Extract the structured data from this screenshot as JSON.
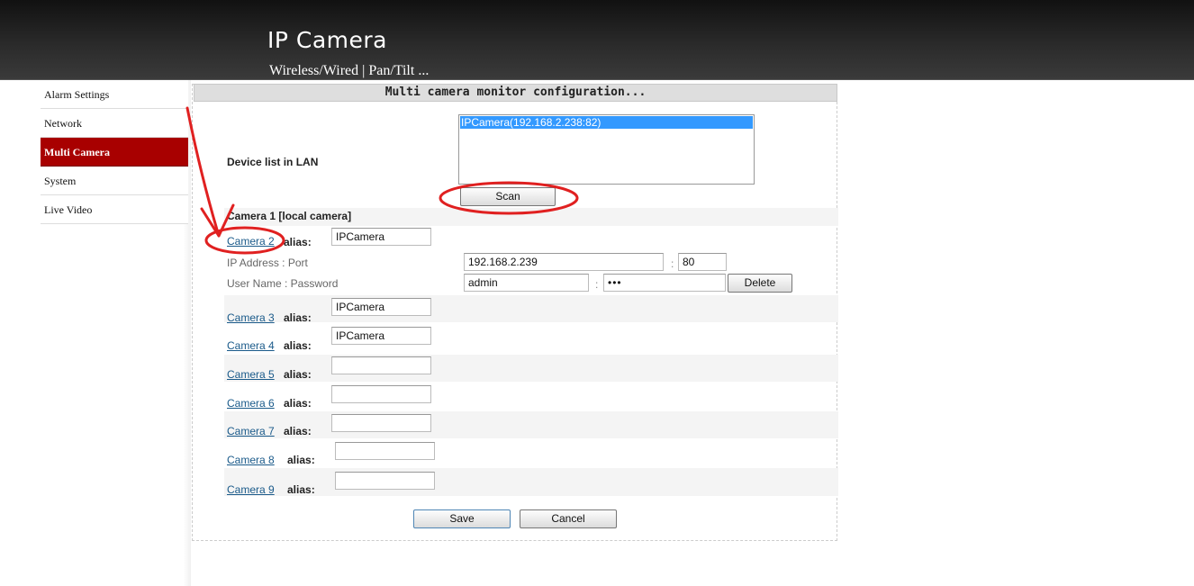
{
  "header": {
    "title": "IP Camera",
    "subtitle": "Wireless/Wired | Pan/Tilt ..."
  },
  "sidebar": {
    "items": [
      {
        "label": "Alarm Settings",
        "active": false
      },
      {
        "label": "Network",
        "active": false
      },
      {
        "label": "Multi Camera",
        "active": true
      },
      {
        "label": "System",
        "active": false
      },
      {
        "label": "Live Video",
        "active": false
      }
    ]
  },
  "panel": {
    "title": "Multi camera monitor configuration..."
  },
  "device_list": {
    "label": "Device list in LAN",
    "options": [
      "IPCamera(192.168.2.238:82)"
    ],
    "selected": "IPCamera(192.168.2.238:82)",
    "scan_label": "Scan"
  },
  "camera1": {
    "label": "Camera 1 [local camera]"
  },
  "alias_label": "alias:",
  "cameras": [
    {
      "link": "Camera 2",
      "alias": "IPCamera"
    },
    {
      "link": "Camera 3",
      "alias": "IPCamera"
    },
    {
      "link": "Camera 4",
      "alias": "IPCamera"
    },
    {
      "link": "Camera 5",
      "alias": ""
    },
    {
      "link": "Camera 6",
      "alias": ""
    },
    {
      "link": "Camera 7",
      "alias": ""
    },
    {
      "link": "Camera 8",
      "alias": ""
    },
    {
      "link": "Camera 9",
      "alias": ""
    }
  ],
  "camera2_details": {
    "ip_port_label": "IP Address : Port",
    "ip": "192.168.2.239",
    "port": "80",
    "user_pass_label": "User Name : Password",
    "user": "admin",
    "password": "•••",
    "delete_label": "Delete",
    "colon": ":"
  },
  "buttons": {
    "save": "Save",
    "cancel": "Cancel"
  },
  "colors": {
    "header_bg": "#1c1c1c",
    "active_menu": "#a80000",
    "annotation": "#e02020",
    "link": "#1a5a8a"
  }
}
